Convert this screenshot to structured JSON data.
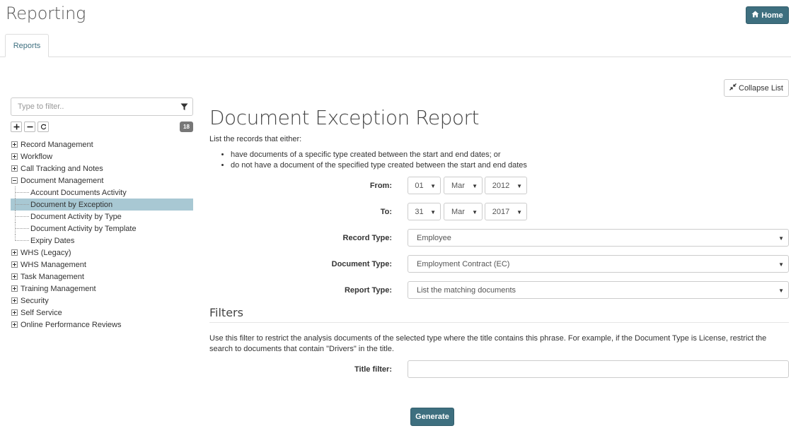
{
  "header": {
    "title": "Reporting",
    "home_label": "Home",
    "home_icon": "home-icon"
  },
  "tabs": [
    {
      "label": "Reports",
      "active": true
    }
  ],
  "sidebar": {
    "filter_placeholder": "Type to filter..",
    "filter_icon": "funnel-icon",
    "tools": [
      "expand-all",
      "collapse-all",
      "refresh"
    ],
    "count": "18",
    "tree": [
      {
        "label": "Record Management",
        "expanded": false
      },
      {
        "label": "Workflow",
        "expanded": false
      },
      {
        "label": "Call Tracking and Notes",
        "expanded": false
      },
      {
        "label": "Document Management",
        "expanded": true,
        "children": [
          {
            "label": "Account Documents Activity",
            "selected": false
          },
          {
            "label": "Document by Exception",
            "selected": true
          },
          {
            "label": "Document Activity by Type",
            "selected": false
          },
          {
            "label": "Document Activity by Template",
            "selected": false
          },
          {
            "label": "Expiry Dates",
            "selected": false
          }
        ]
      },
      {
        "label": "WHS (Legacy)",
        "expanded": false
      },
      {
        "label": "WHS Management",
        "expanded": false
      },
      {
        "label": "Task Management",
        "expanded": false
      },
      {
        "label": "Training Management",
        "expanded": false
      },
      {
        "label": "Security",
        "expanded": false
      },
      {
        "label": "Self Service",
        "expanded": false
      },
      {
        "label": "Online Performance Reviews",
        "expanded": false
      }
    ]
  },
  "main": {
    "collapse_label": "Collapse List",
    "report_title": "Document Exception Report",
    "intro": "List the records that either:",
    "bullets": [
      "have documents of a specific type created between the start and end dates; or",
      "do not have a document of the specified type created between the start and end dates"
    ],
    "form": {
      "from_label": "From:",
      "from_day": "01",
      "from_month": "Mar",
      "from_year": "2012",
      "to_label": "To:",
      "to_day": "31",
      "to_month": "Mar",
      "to_year": "2017",
      "record_type_label": "Record Type:",
      "record_type": "Employee",
      "document_type_label": "Document Type:",
      "document_type": "Employment Contract (EC)",
      "report_type_label": "Report Type:",
      "report_type": "List the matching documents"
    },
    "filters": {
      "title": "Filters",
      "description": "Use this filter to restrict the analysis documents of the selected type where the title contains this phrase. For example, if the Document Type is License, restrict the search to documents that contain \"Drivers\" in the title.",
      "title_filter_label": "Title filter:",
      "title_filter_value": ""
    },
    "generate_label": "Generate"
  },
  "colors": {
    "primary": "#3e6f7f",
    "selected_row": "#a8c8d3",
    "badge": "#777777"
  }
}
